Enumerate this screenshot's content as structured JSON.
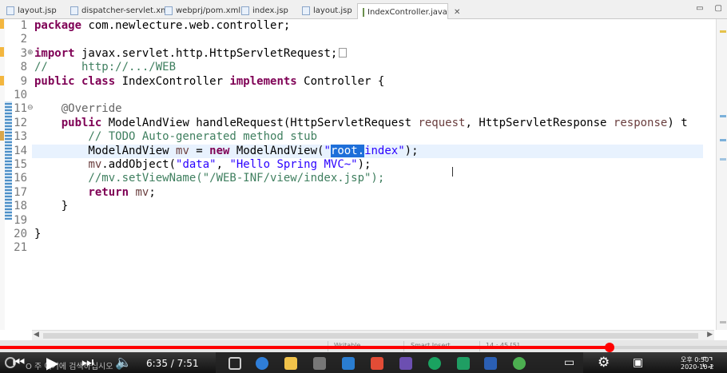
{
  "tabs": [
    {
      "label": "layout.jsp",
      "active": false
    },
    {
      "label": "dispatcher-servlet.xml",
      "active": false
    },
    {
      "label": "webprj/pom.xml",
      "active": false
    },
    {
      "label": "index.jsp",
      "active": false
    },
    {
      "label": "layout.jsp",
      "active": false
    },
    {
      "label": "IndexController.java",
      "active": true
    }
  ],
  "tab_tools": {
    "close": "✕",
    "minimize": "▭",
    "maximize": "▢"
  },
  "lines": [
    {
      "num": "1",
      "fold": ""
    },
    {
      "num": "2",
      "fold": ""
    },
    {
      "num": "3",
      "fold": "⊕"
    },
    {
      "num": "8",
      "fold": ""
    },
    {
      "num": "9",
      "fold": ""
    },
    {
      "num": "10",
      "fold": ""
    },
    {
      "num": "11",
      "fold": "⊖"
    },
    {
      "num": "12",
      "fold": ""
    },
    {
      "num": "13",
      "fold": ""
    },
    {
      "num": "14",
      "fold": ""
    },
    {
      "num": "15",
      "fold": ""
    },
    {
      "num": "16",
      "fold": ""
    },
    {
      "num": "17",
      "fold": ""
    },
    {
      "num": "18",
      "fold": ""
    },
    {
      "num": "19",
      "fold": ""
    },
    {
      "num": "20",
      "fold": ""
    },
    {
      "num": "21",
      "fold": ""
    }
  ],
  "code": {
    "l1_kw": "package",
    "l1_rest": " com.newlecture.web.controller;",
    "l3_kw": "import",
    "l3_rest": " javax.servlet.http.HttpServletRequest;",
    "l8": "//     http://.../WEB",
    "l9_kw1": "public class",
    "l9_mid": " IndexController ",
    "l9_kw2": "implements",
    "l9_rest": " Controller {",
    "l11": "    @Override",
    "l12_kw": "    public",
    "l12_a": " ModelAndView handleRequest(HttpServletRequest ",
    "l12_p1": "request",
    "l12_b": ", HttpServletResponse ",
    "l12_p2": "response",
    "l12_c": ") t",
    "l13": "        // TODO Auto-generated method stub",
    "l14_a": "        ModelAndView ",
    "l14_v": "mv",
    "l14_b": " = ",
    "l14_kw": "new",
    "l14_c": " ModelAndView(",
    "l14_q": "\"",
    "l14_sel": "root.",
    "l14_s2": "index\"",
    "l14_d": ");",
    "l15_a": "        ",
    "l15_v": "mv",
    "l15_b": ".addObject(",
    "l15_s1": "\"data\"",
    "l15_c": ", ",
    "l15_s2": "\"Hello Spring MVC~\"",
    "l15_d": ");",
    "l16": "        //mv.setViewName(\"/WEB-INF/view/index.jsp\");",
    "l17_kw": "        return",
    "l17_sp": " ",
    "l17_v": "mv",
    "l17_d": ";",
    "l18": "    }",
    "l20": "}"
  },
  "status": {
    "writable": "Writable",
    "insert_mode": "Smart Insert",
    "position": "14 : 45 [5]"
  },
  "video": {
    "current_time": "6:35",
    "separator": " / ",
    "duration": "7:51",
    "progress": 0.838,
    "search_text": "여기에 검색하십시오",
    "search_hint": "O 주",
    "clock_time": "오후 0:50",
    "clock_date": "2020-10-2"
  },
  "colors": {
    "accent": "#ff0000",
    "keyword": "#7f0055",
    "comment": "#3f7f5f",
    "string": "#2a00ff",
    "selection": "#1e6fd9"
  }
}
